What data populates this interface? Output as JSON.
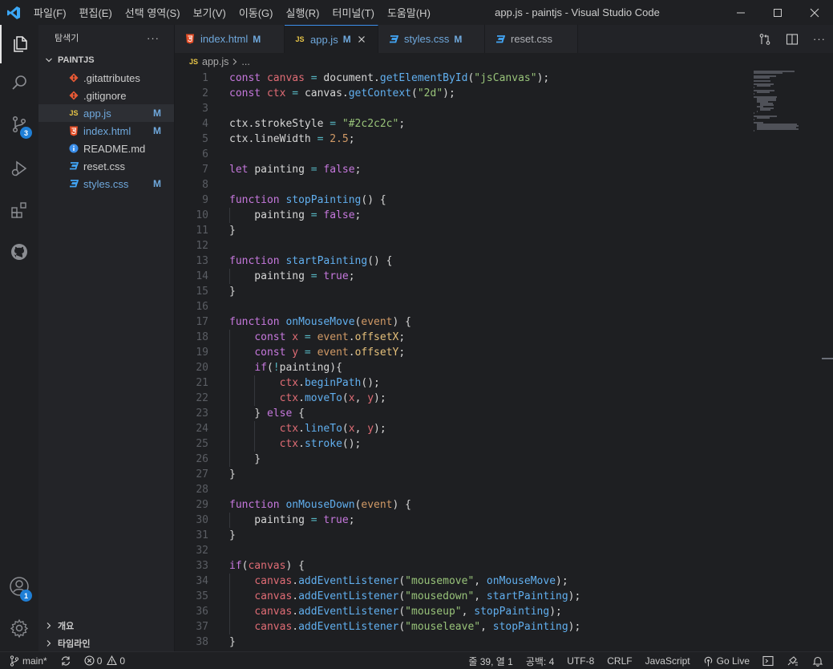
{
  "colors": {
    "accent": "#3b8eea",
    "modified": "#6fa8dc",
    "badge": "#1f7fd6",
    "html_icon": "#e44d26",
    "css_icon": "#42a5f5",
    "js_icon": "#e8c547",
    "git_icon": "#e55935",
    "info_icon": "#3b8eea"
  },
  "menu": [
    "파일(F)",
    "편집(E)",
    "선택 영역(S)",
    "보기(V)",
    "이동(G)",
    "실행(R)",
    "터미널(T)",
    "도움말(H)"
  ],
  "window_title": "app.js - paintjs - Visual Studio Code",
  "activity": {
    "scm_badge": "3",
    "accounts_badge": "1"
  },
  "sidebar": {
    "title": "탐색기",
    "more": "···",
    "project": "PAINTJS",
    "files": [
      {
        "name": ".gitattributes",
        "icon": "git-icon",
        "status": ""
      },
      {
        "name": ".gitignore",
        "icon": "git-icon",
        "status": ""
      },
      {
        "name": "app.js",
        "icon": "js-icon",
        "status": "M"
      },
      {
        "name": "index.html",
        "icon": "html-icon",
        "status": "M"
      },
      {
        "name": "README.md",
        "icon": "info-icon",
        "status": ""
      },
      {
        "name": "reset.css",
        "icon": "css-icon",
        "status": ""
      },
      {
        "name": "styles.css",
        "icon": "css-icon",
        "status": "M"
      }
    ],
    "outline": "개요",
    "timeline": "타임라인"
  },
  "tabs": [
    {
      "name": "index.html",
      "icon": "html-icon",
      "status": "M"
    },
    {
      "name": "app.js",
      "icon": "js-icon",
      "status": "M"
    },
    {
      "name": "styles.css",
      "icon": "css-icon",
      "status": "M"
    },
    {
      "name": "reset.css",
      "icon": "css-icon",
      "status": ""
    }
  ],
  "breadcrumb": {
    "file": "app.js",
    "tail": "..."
  },
  "code_lines": [
    [
      [
        "kw",
        "const "
      ],
      [
        "var",
        "canvas"
      ],
      [
        "op",
        " = "
      ],
      [
        "plain",
        "document."
      ],
      [
        "fn",
        "getElementById"
      ],
      [
        "plain",
        "("
      ],
      [
        "str",
        "\"jsCanvas\""
      ],
      [
        "plain",
        ");"
      ]
    ],
    [
      [
        "kw",
        "const "
      ],
      [
        "var",
        "ctx"
      ],
      [
        "op",
        " = "
      ],
      [
        "plain",
        "canvas."
      ],
      [
        "fn",
        "getContext"
      ],
      [
        "plain",
        "("
      ],
      [
        "str",
        "\"2d\""
      ],
      [
        "plain",
        ");"
      ]
    ],
    [],
    [
      [
        "plain",
        "ctx.strokeStyle "
      ],
      [
        "op",
        "= "
      ],
      [
        "str",
        "\"#2c2c2c\""
      ],
      [
        "plain",
        ";"
      ]
    ],
    [
      [
        "plain",
        "ctx.lineWidth "
      ],
      [
        "op",
        "= "
      ],
      [
        "num",
        "2.5"
      ],
      [
        "plain",
        ";"
      ]
    ],
    [],
    [
      [
        "kw",
        "let "
      ],
      [
        "plain",
        "painting "
      ],
      [
        "op",
        "= "
      ],
      [
        "bool",
        "false"
      ],
      [
        "plain",
        ";"
      ]
    ],
    [],
    [
      [
        "kw",
        "function "
      ],
      [
        "fn",
        "stopPainting"
      ],
      [
        "plain",
        "() {"
      ]
    ],
    [
      [
        "plain",
        "    painting "
      ],
      [
        "op",
        "= "
      ],
      [
        "bool",
        "false"
      ],
      [
        "plain",
        ";"
      ]
    ],
    [
      [
        "plain",
        "}"
      ]
    ],
    [],
    [
      [
        "kw",
        "function "
      ],
      [
        "fn",
        "startPainting"
      ],
      [
        "plain",
        "() {"
      ]
    ],
    [
      [
        "plain",
        "    painting "
      ],
      [
        "op",
        "= "
      ],
      [
        "bool",
        "true"
      ],
      [
        "plain",
        ";"
      ]
    ],
    [
      [
        "plain",
        "}"
      ]
    ],
    [],
    [
      [
        "kw",
        "function "
      ],
      [
        "fn",
        "onMouseMove"
      ],
      [
        "plain",
        "("
      ],
      [
        "param",
        "event"
      ],
      [
        "plain",
        ") {"
      ]
    ],
    [
      [
        "plain",
        "    "
      ],
      [
        "kw",
        "const "
      ],
      [
        "var",
        "x"
      ],
      [
        "op",
        " = "
      ],
      [
        "param",
        "event"
      ],
      [
        "plain",
        "."
      ],
      [
        "obj",
        "offsetX"
      ],
      [
        "plain",
        ";"
      ]
    ],
    [
      [
        "plain",
        "    "
      ],
      [
        "kw",
        "const "
      ],
      [
        "var",
        "y"
      ],
      [
        "op",
        " = "
      ],
      [
        "param",
        "event"
      ],
      [
        "plain",
        "."
      ],
      [
        "obj",
        "offsetY"
      ],
      [
        "plain",
        ";"
      ]
    ],
    [
      [
        "plain",
        "    "
      ],
      [
        "kw",
        "if"
      ],
      [
        "plain",
        "("
      ],
      [
        "op",
        "!"
      ],
      [
        "plain",
        "painting){"
      ]
    ],
    [
      [
        "plain",
        "        "
      ],
      [
        "prop",
        "ctx"
      ],
      [
        "plain",
        "."
      ],
      [
        "fn",
        "beginPath"
      ],
      [
        "plain",
        "();"
      ]
    ],
    [
      [
        "plain",
        "        "
      ],
      [
        "prop",
        "ctx"
      ],
      [
        "plain",
        "."
      ],
      [
        "fn",
        "moveTo"
      ],
      [
        "plain",
        "("
      ],
      [
        "var",
        "x"
      ],
      [
        "plain",
        ", "
      ],
      [
        "var",
        "y"
      ],
      [
        "plain",
        ");"
      ]
    ],
    [
      [
        "plain",
        "    } "
      ],
      [
        "kw",
        "else "
      ],
      [
        "plain",
        "{"
      ]
    ],
    [
      [
        "plain",
        "        "
      ],
      [
        "prop",
        "ctx"
      ],
      [
        "plain",
        "."
      ],
      [
        "fn",
        "lineTo"
      ],
      [
        "plain",
        "("
      ],
      [
        "var",
        "x"
      ],
      [
        "plain",
        ", "
      ],
      [
        "var",
        "y"
      ],
      [
        "plain",
        ");"
      ]
    ],
    [
      [
        "plain",
        "        "
      ],
      [
        "prop",
        "ctx"
      ],
      [
        "plain",
        "."
      ],
      [
        "fn",
        "stroke"
      ],
      [
        "plain",
        "();"
      ]
    ],
    [
      [
        "plain",
        "    }"
      ]
    ],
    [
      [
        "plain",
        "}"
      ]
    ],
    [],
    [
      [
        "kw",
        "function "
      ],
      [
        "fn",
        "onMouseDown"
      ],
      [
        "plain",
        "("
      ],
      [
        "param",
        "event"
      ],
      [
        "plain",
        ") {"
      ]
    ],
    [
      [
        "plain",
        "    painting "
      ],
      [
        "op",
        "= "
      ],
      [
        "bool",
        "true"
      ],
      [
        "plain",
        ";"
      ]
    ],
    [
      [
        "plain",
        "}"
      ]
    ],
    [],
    [
      [
        "kw",
        "if"
      ],
      [
        "plain",
        "("
      ],
      [
        "prop",
        "canvas"
      ],
      [
        "plain",
        ") {"
      ]
    ],
    [
      [
        "plain",
        "    "
      ],
      [
        "prop",
        "canvas"
      ],
      [
        "plain",
        "."
      ],
      [
        "fn",
        "addEventListener"
      ],
      [
        "plain",
        "("
      ],
      [
        "str",
        "\"mousemove\""
      ],
      [
        "plain",
        ", "
      ],
      [
        "fn",
        "onMouseMove"
      ],
      [
        "plain",
        ");"
      ]
    ],
    [
      [
        "plain",
        "    "
      ],
      [
        "prop",
        "canvas"
      ],
      [
        "plain",
        "."
      ],
      [
        "fn",
        "addEventListener"
      ],
      [
        "plain",
        "("
      ],
      [
        "str",
        "\"mousedown\""
      ],
      [
        "plain",
        ", "
      ],
      [
        "fn",
        "startPainting"
      ],
      [
        "plain",
        ");"
      ]
    ],
    [
      [
        "plain",
        "    "
      ],
      [
        "prop",
        "canvas"
      ],
      [
        "plain",
        "."
      ],
      [
        "fn",
        "addEventListener"
      ],
      [
        "plain",
        "("
      ],
      [
        "str",
        "\"mouseup\""
      ],
      [
        "plain",
        ", "
      ],
      [
        "fn",
        "stopPainting"
      ],
      [
        "plain",
        ");"
      ]
    ],
    [
      [
        "plain",
        "    "
      ],
      [
        "prop",
        "canvas"
      ],
      [
        "plain",
        "."
      ],
      [
        "fn",
        "addEventListener"
      ],
      [
        "plain",
        "("
      ],
      [
        "str",
        "\"mouseleave\""
      ],
      [
        "plain",
        ", "
      ],
      [
        "fn",
        "stopPainting"
      ],
      [
        "plain",
        ");"
      ]
    ],
    [
      [
        "plain",
        "}"
      ]
    ]
  ],
  "status": {
    "branch": "main*",
    "errors": "0",
    "warnings": "0",
    "position": "줄 39, 열 1",
    "spaces": "공백: 4",
    "encoding": "UTF-8",
    "eol": "CRLF",
    "language": "JavaScript",
    "golive": "Go Live"
  }
}
